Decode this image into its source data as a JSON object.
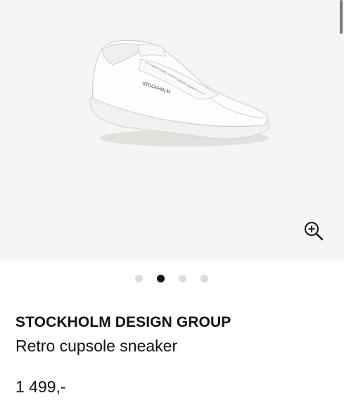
{
  "gallery": {
    "image_alt": "White leather sneaker",
    "shoe_print": "STOCKHOLM",
    "zoom_icon": "zoom-in-icon",
    "page_count": 4,
    "active_page": 2
  },
  "product": {
    "brand": "STOCKHOLM DESIGN GROUP",
    "name": "Retro cupsole sneaker",
    "price": "1 499,-"
  },
  "colors": {
    "gallery_bg": "#f6f5f3",
    "dot_active": "#111111",
    "dot_inactive": "#dcdcdc",
    "text": "#111111"
  }
}
